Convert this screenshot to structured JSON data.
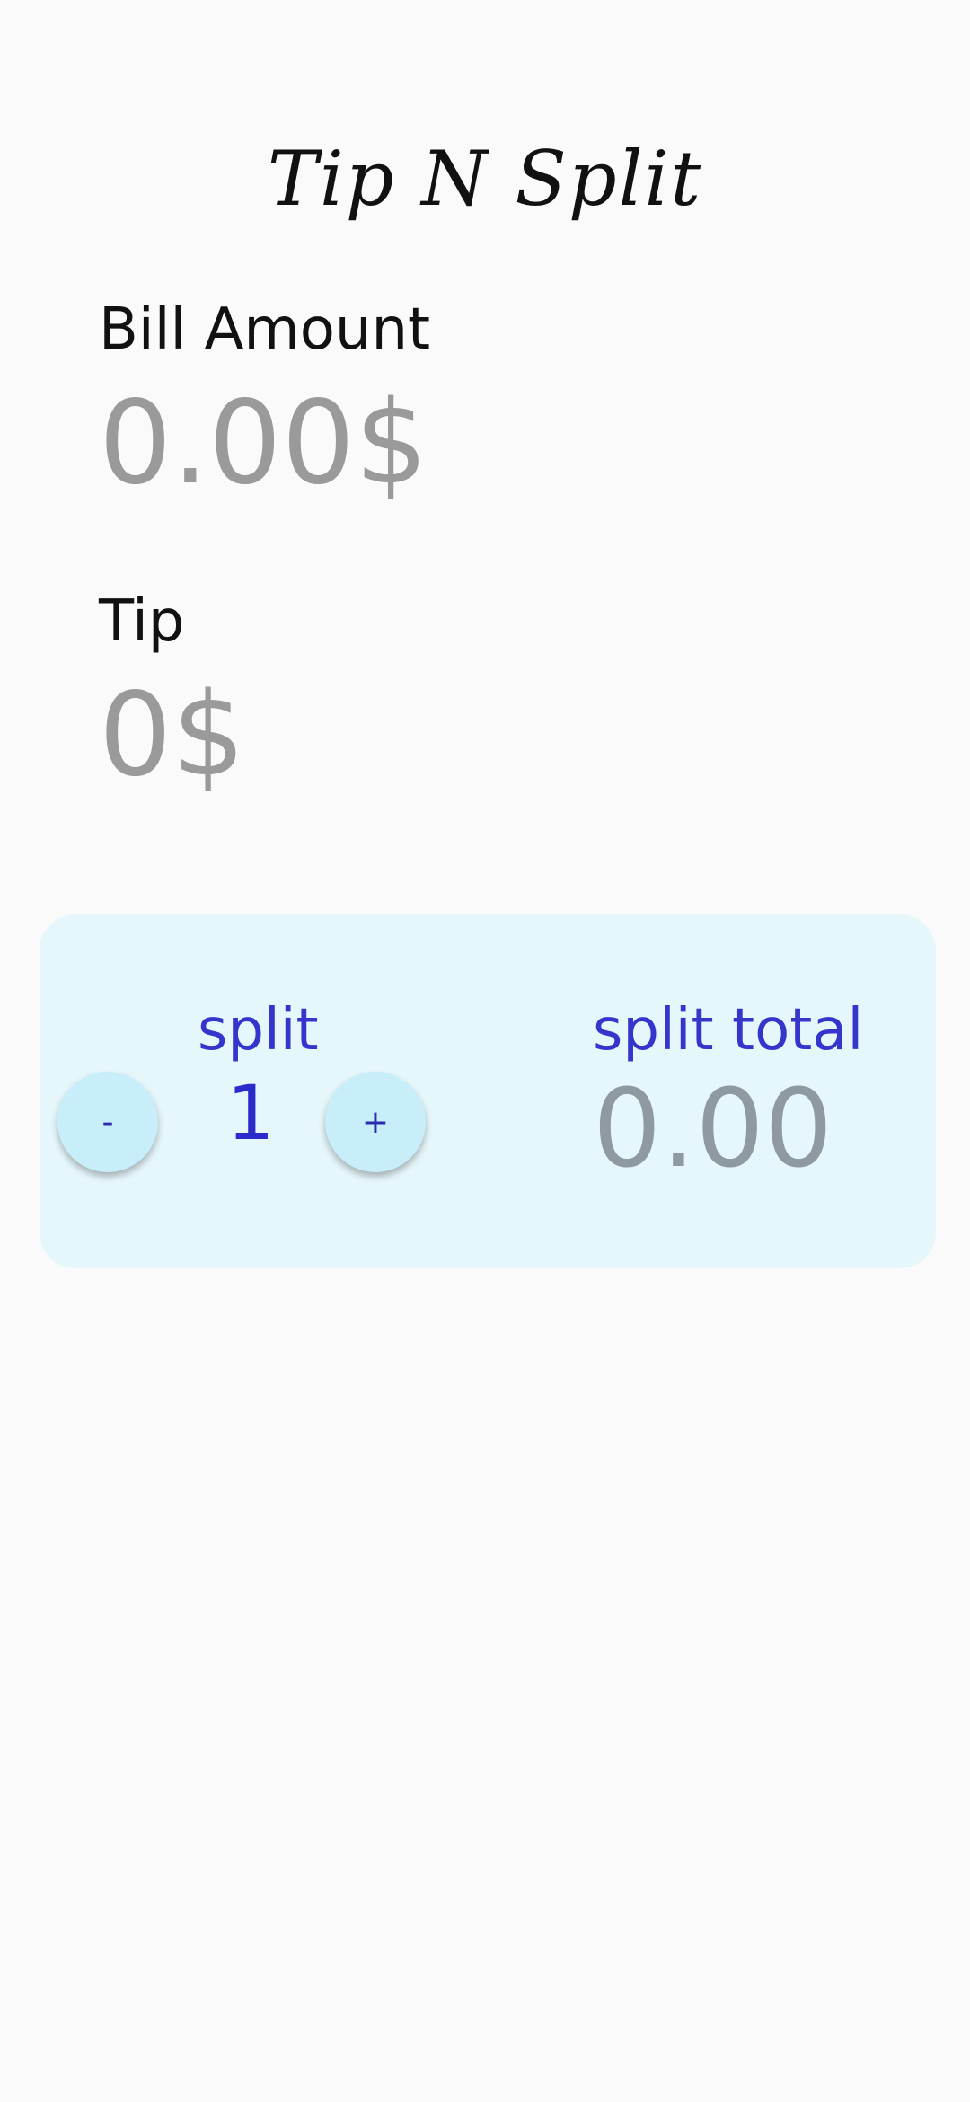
{
  "app": {
    "title": "Tip N Split"
  },
  "bill": {
    "label": "Bill Amount",
    "value": "0.00$"
  },
  "tip": {
    "label": "Tip",
    "value": "0$"
  },
  "split": {
    "label": "split",
    "decrement_label": "-",
    "count": "1",
    "increment_label": "+",
    "total_label": "split total",
    "total_value": "0.00"
  },
  "colors": {
    "background": "#fafafa",
    "card": "#e6f7fc",
    "button": "#c7eef9",
    "accent": "#3535cc",
    "muted_value": "#9a9a9a"
  }
}
